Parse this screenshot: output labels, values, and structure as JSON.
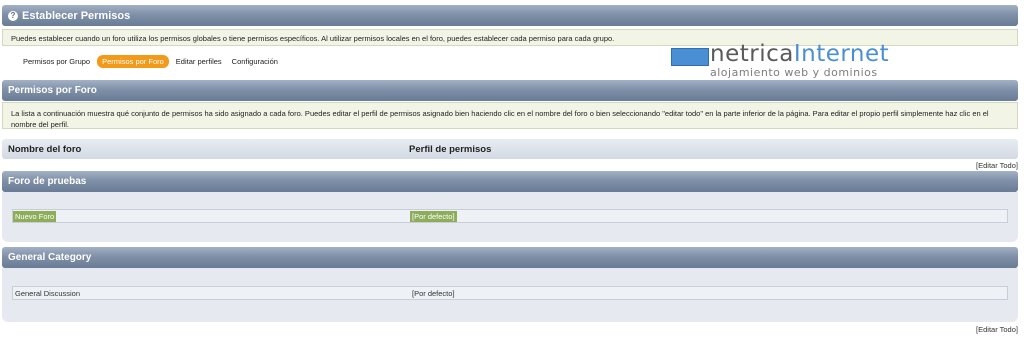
{
  "header": {
    "title": "Establecer Permisos",
    "help_icon": "?"
  },
  "intro": "Puedes establecer cuando un foro utiliza los permisos globales o tiene permisos específicos. Al utilizar permisos locales en el foro, puedes establecer cada permiso para cada grupo.",
  "nav": {
    "items": [
      {
        "label": "Permisos por Grupo",
        "active": false
      },
      {
        "label": "Permisos por Foro",
        "active": true
      },
      {
        "label": "Editar perfiles",
        "active": false
      },
      {
        "label": "Configuración",
        "active": false
      }
    ]
  },
  "logo": {
    "word_a": "netrica",
    "word_b": "Internet",
    "tagline": "alojamiento web y dominios",
    "accent": "#4a8fd4"
  },
  "section": {
    "title": "Permisos por Foro",
    "description": "La lista a continuación muestra qué conjunto de permisos ha sido asignado a cada foro. Puedes editar el perfil de permisos asignado bien haciendo clic en el nombre del foro o bien seleccionando \"editar todo\" en la parte inferior de la página. Para editar el propio perfil simplemente haz clic en el nombre del perfil."
  },
  "table": {
    "col_forum": "Nombre del foro",
    "col_profile": "Perfil de permisos",
    "edit_all": "[Editar Todo]"
  },
  "categories": [
    {
      "title": "Foro de pruebas",
      "forum": "Nuevo Foro",
      "profile": "[Por defecto]",
      "highlighted": true
    },
    {
      "title": "General Category",
      "forum": "General Discussion",
      "profile": "[Por defecto]",
      "highlighted": false
    }
  ]
}
